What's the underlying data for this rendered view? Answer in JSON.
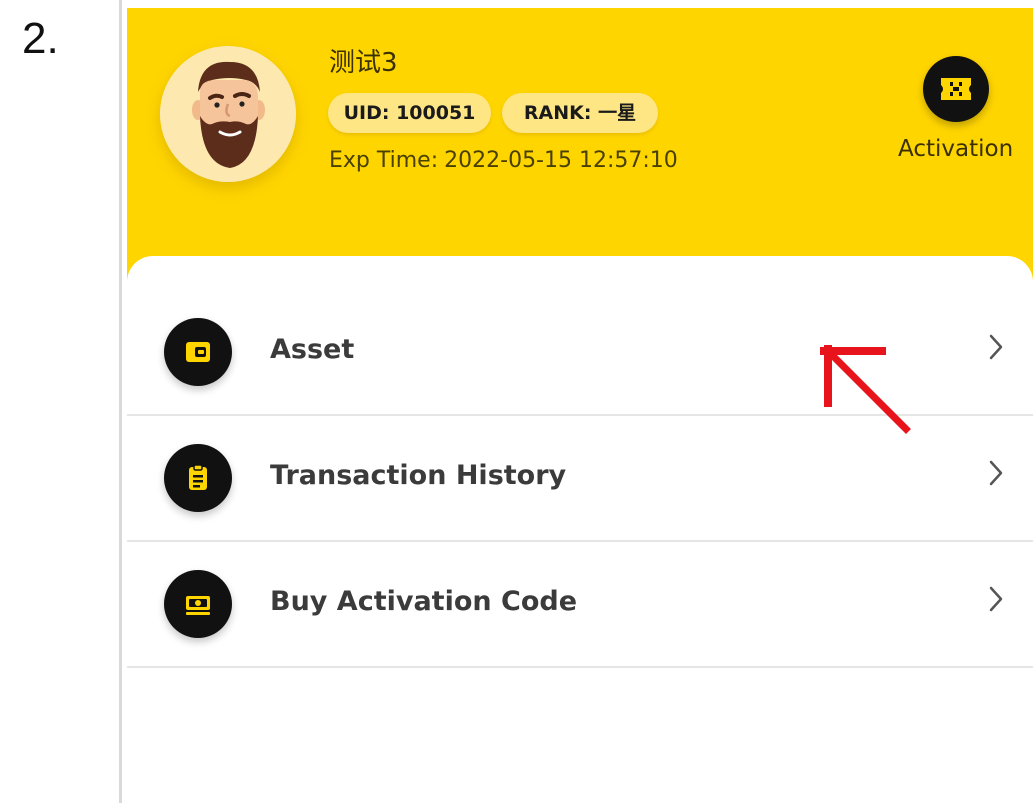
{
  "step": {
    "number": "2."
  },
  "profile": {
    "name": "测试3",
    "uid": "UID: 100051",
    "rank": "RANK: 一星",
    "exp_label": "Exp Time:",
    "exp_value": "2022-05-15 12:57:10",
    "avatar": "bearded-man-avatar"
  },
  "activation": {
    "label": "Activation",
    "icon": "ticket-icon"
  },
  "menu": {
    "items": [
      {
        "label": "Asset",
        "icon": "wallet-icon"
      },
      {
        "label": "Transaction History",
        "icon": "clipboard-icon"
      },
      {
        "label": "Buy Activation Code",
        "icon": "money-icon"
      }
    ]
  },
  "colors": {
    "brand_yellow": "#FFD500",
    "badge_yellow": "#FFE685",
    "icon_dark": "#111111",
    "annotation_red": "#E8141B"
  }
}
